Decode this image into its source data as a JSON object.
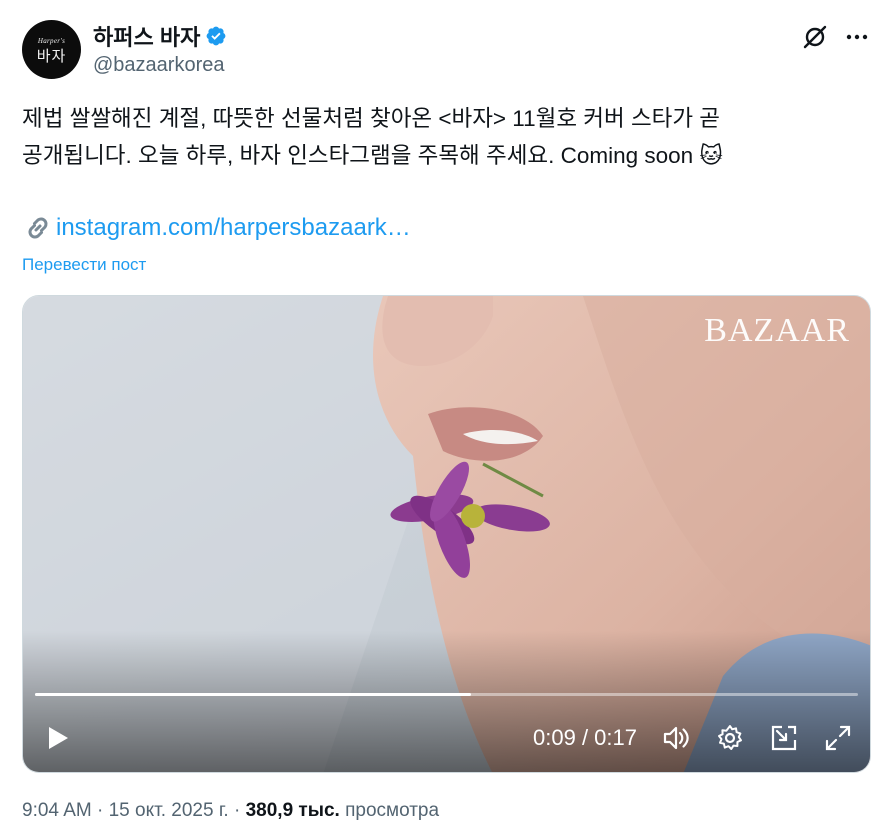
{
  "author": {
    "avatar_small_text": "Harper's",
    "avatar_big_text": "바자",
    "display_name": "하퍼스 바자",
    "handle": "@bazaarkorea",
    "verified": true
  },
  "icons": {
    "verified": "verified-badge-icon",
    "grok": "grok-icon",
    "more": "more-icon",
    "link": "link-icon"
  },
  "colors": {
    "accent": "#1d9bf0",
    "text": "#0f1419",
    "secondary": "#536471"
  },
  "tweet": {
    "line1": "제법 쌀쌀해진 계절, 따뜻한 선물처럼 찾아온 <바자> 11월호 커버 스타가 곧",
    "line2": "공개됩니다. 오늘 하루, 바자 인스타그램을 주목해 주세요. Coming soon 🐱",
    "link": "instagram.com/harpersbazaark…",
    "translate": "Перевести пост"
  },
  "media": {
    "watermark": "BAZAAR",
    "progress": 0.53,
    "time_current": "0:09",
    "time_separator": " / ",
    "time_total": "0:17"
  },
  "meta": {
    "time": "9:04 AM",
    "sep1": " · ",
    "date": "15 окт. 2025 г.",
    "sep2": " · ",
    "views_count": "380,9 тыс.",
    "views_label": " просмотра"
  }
}
